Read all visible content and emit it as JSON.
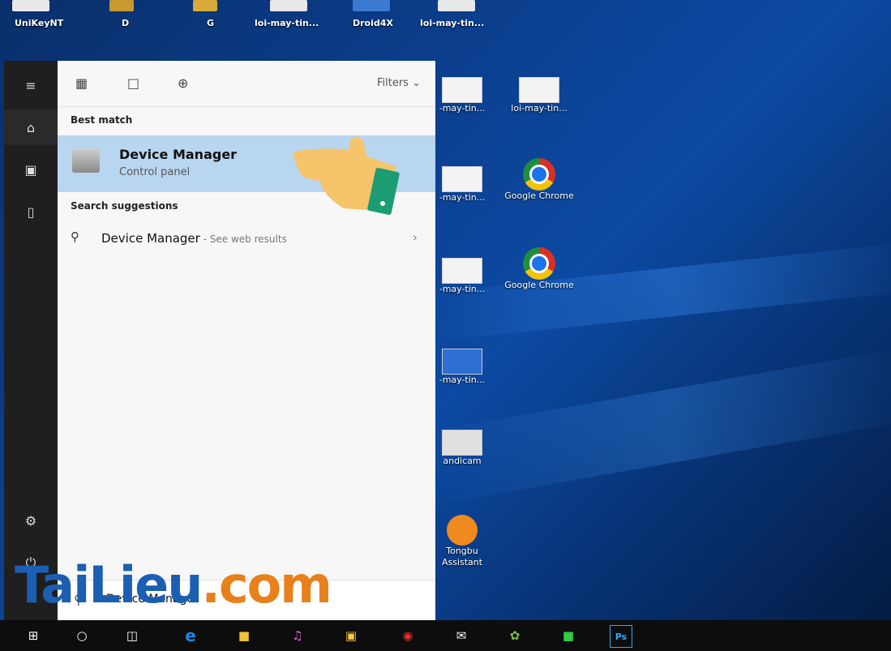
{
  "desktop_top": {
    "items": [
      "UniKeyNT",
      "D",
      "G",
      "loi-may-tin...",
      "Droid4X",
      "loi-may-tin..."
    ]
  },
  "desktop_right": {
    "items": [
      {
        "label": "-may-tin...",
        "type": "file"
      },
      {
        "label": "loi-may-tin...",
        "type": "file"
      },
      {
        "label": "-may-tin...",
        "type": "file"
      },
      {
        "label": "Google Chrome",
        "type": "chrome"
      },
      {
        "label": "-may-tin...",
        "type": "file"
      },
      {
        "label": "Google Chrome",
        "type": "chrome"
      },
      {
        "label": "-may-tin...",
        "type": "file"
      },
      {
        "label": "andicam",
        "type": "file"
      },
      {
        "label": "Tongbu Assistant",
        "type": "app"
      }
    ]
  },
  "start": {
    "left_icons": [
      "hamburger-icon",
      "home-icon",
      "documents-icon",
      "phone-icon",
      "settings-icon",
      "power-icon"
    ],
    "tabs": [
      "apps-icon",
      "document-icon",
      "web-icon"
    ],
    "filters_label": "Filters",
    "best_match_heading": "Best match",
    "best_match": {
      "title": "Device Manager",
      "subtitle": "Control panel"
    },
    "suggestions_heading": "Search suggestions",
    "suggestion": {
      "main": "Device Manager",
      "sub": " - See web results"
    },
    "search_value": "Device Manager"
  },
  "watermark": {
    "part1": "TaiLieu",
    "part2": ".com"
  },
  "taskbar": {
    "icons": [
      "start-icon",
      "cortana-icon",
      "task-view-icon",
      "edge-icon",
      "file-explorer-icon",
      "itunes-icon",
      "store-icon",
      "app-icon-red",
      "mail-icon",
      "app-icon-green",
      "line-icon",
      "photoshop-icon"
    ],
    "ps_label": "Ps"
  },
  "colors": {
    "highlight": "#b9d6f0",
    "panel": "#f7f7f7",
    "leftbar": "#1f1f1f",
    "taskbar": "#0d0d0d"
  }
}
